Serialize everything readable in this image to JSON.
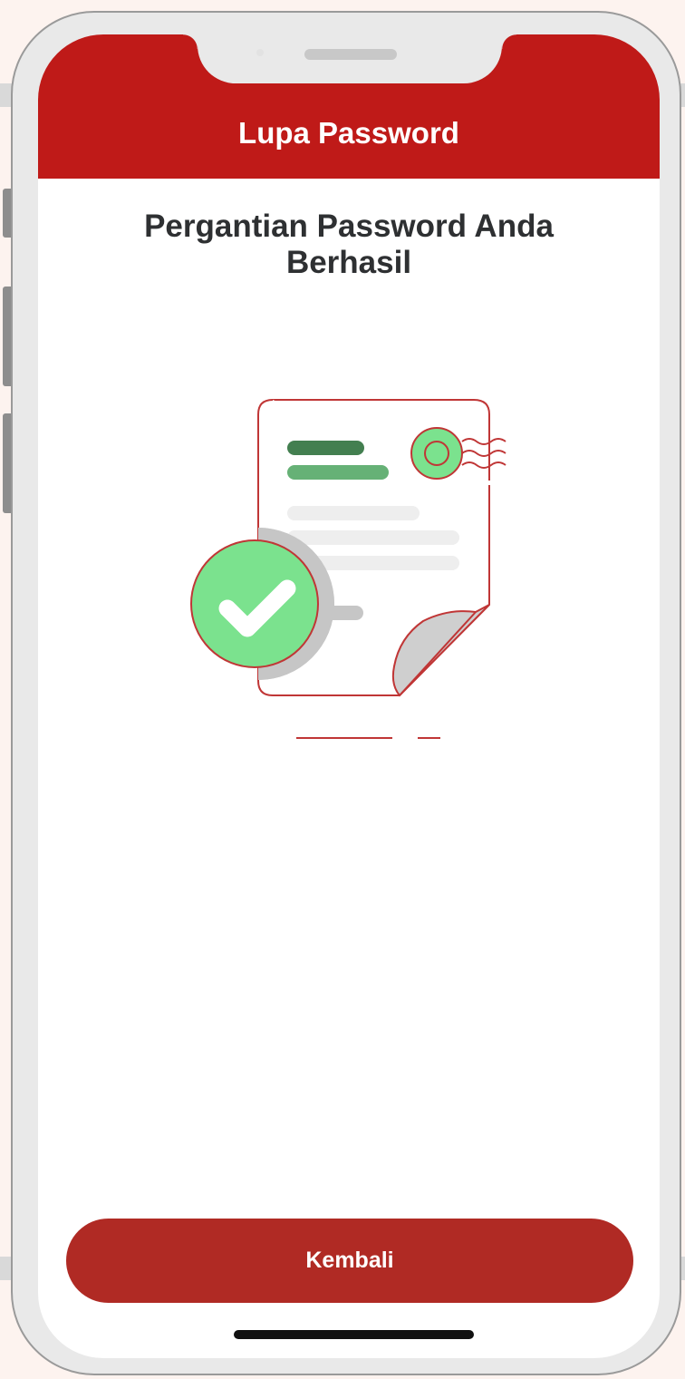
{
  "header": {
    "title": "Lupa Password"
  },
  "message": {
    "line1": "Pergantian Password Anda",
    "line2": "Berhasil"
  },
  "illustration": {
    "icon": "document-success-icon",
    "accent_color": "#bf1a18",
    "success_color": "#7be28e"
  },
  "actions": {
    "back_label": "Kembali"
  },
  "colors": {
    "header_bg": "#bf1a18",
    "button_bg": "#b02a24",
    "page_bg": "#fdf3ef"
  }
}
